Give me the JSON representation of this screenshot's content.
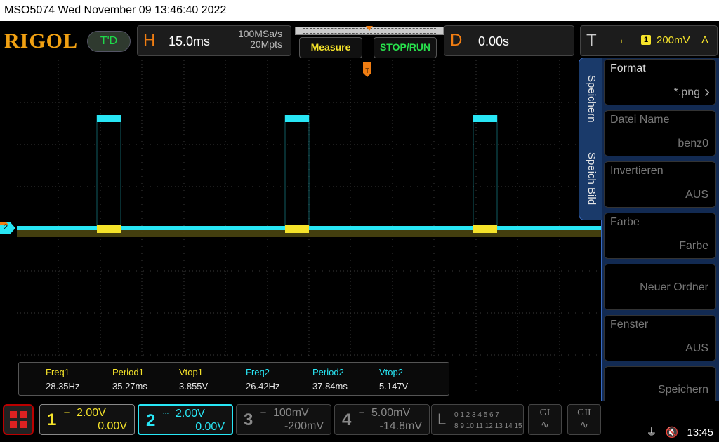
{
  "title_bar": {
    "text": "MSO5074  Wed November 09 13:46:40 2022"
  },
  "toolbar": {
    "logo": "RIGOL",
    "mode_badge": "T'D",
    "horizontal": {
      "letter": "H",
      "timebase": "15.0ms",
      "sample_rate": "100MSa/s",
      "memory_depth": "20Mpts"
    },
    "measure_label": "Measure",
    "stoprun_label": "STOP/RUN",
    "delay": {
      "letter": "D",
      "value": "0.00s"
    },
    "trigger": {
      "letter": "T",
      "source": "1",
      "level": "200mV",
      "mode": "A",
      "icon": "rising-edge-icon"
    }
  },
  "screen": {
    "trigger_marker": "T",
    "ch2_marker": "2",
    "colors": {
      "ch1": "#f5e32a",
      "ch2": "#28e6f5",
      "grid": "#555555"
    }
  },
  "measurements": [
    {
      "label": "Freq1",
      "value": "28.35Hz",
      "channel": 1
    },
    {
      "label": "Period1",
      "value": "35.27ms",
      "channel": 1
    },
    {
      "label": "Vtop1",
      "value": "3.855V",
      "channel": 1
    },
    {
      "label": "Freq2",
      "value": "26.42Hz",
      "channel": 2
    },
    {
      "label": "Period2",
      "value": "37.84ms",
      "channel": 2
    },
    {
      "label": "Vtop2",
      "value": "5.147V",
      "channel": 2
    }
  ],
  "side_tabs": [
    "Speichern",
    "Speich Bild"
  ],
  "menu": [
    {
      "title": "Format",
      "value": "*.png",
      "chevron": "›"
    },
    {
      "title": "Datei Name",
      "value": "benz0",
      "disabled": true
    },
    {
      "title": "Invertieren",
      "value": "AUS",
      "disabled": true
    },
    {
      "title": "Farbe",
      "value": "Farbe",
      "disabled": true
    },
    {
      "title": "",
      "value": "Neuer Ordner",
      "disabled": true
    },
    {
      "title": "Fenster",
      "value": "AUS",
      "disabled": true
    },
    {
      "title": "",
      "value": "Speichern",
      "disabled": true
    }
  ],
  "channels": [
    {
      "num": "1",
      "scale": "2.00V",
      "offset": "0.00V"
    },
    {
      "num": "2",
      "scale": "2.00V",
      "offset": "0.00V"
    },
    {
      "num": "3",
      "scale": "100mV",
      "offset": "-200mV"
    },
    {
      "num": "4",
      "scale": "5.00mV",
      "offset": "-14.8mV"
    }
  ],
  "logic": {
    "label": "L",
    "row1": "0 1 2 3  4 5 6 7",
    "row2": "8 9 10 11 12 13 14 15"
  },
  "generators": [
    {
      "label": "GI"
    },
    {
      "label": "GII"
    }
  ],
  "status": {
    "time": "13:45",
    "usb_icon": "usb-icon",
    "sound_icon": "mute-icon"
  }
}
